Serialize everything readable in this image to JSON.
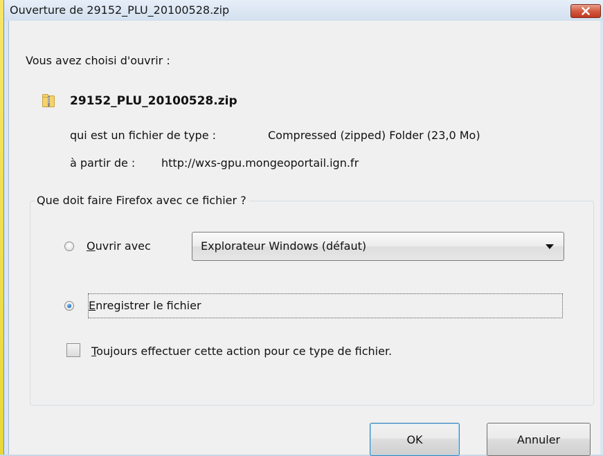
{
  "window": {
    "title": "Ouverture de 29152_PLU_20100528.zip"
  },
  "intro_text": "Vous avez choisi d'ouvrir :",
  "file": {
    "name": "29152_PLU_20100528.zip",
    "type_label": "qui est un fichier de type :",
    "type_value": "Compressed (zipped) Folder (23,0 Mo)",
    "source_label": "à partir de :",
    "source_value": "http://wxs-gpu.mongeoportail.ign.fr"
  },
  "group": {
    "legend": "Que doit faire Firefox avec ce fichier ?",
    "open_with": {
      "accel": "O",
      "rest": "uvrir avec",
      "selected": false,
      "app_selected": "Explorateur Windows (défaut)"
    },
    "save_file": {
      "accel": "E",
      "rest": "nregistrer le fichier",
      "selected": true
    },
    "always": {
      "accel": "T",
      "rest": "oujours effectuer cette action pour ce type de fichier.",
      "checked": false
    }
  },
  "buttons": {
    "ok": "OK",
    "cancel": "Annuler"
  },
  "icons": {
    "close": "close-icon",
    "file": "zip-folder-icon",
    "dropdown": "dropdown-arrow-icon"
  },
  "colors": {
    "close_button": "#c1381e",
    "titlebar": "#dbe6f3",
    "client": "#f0f0f0",
    "radio_selected": "#1f6fc0"
  }
}
